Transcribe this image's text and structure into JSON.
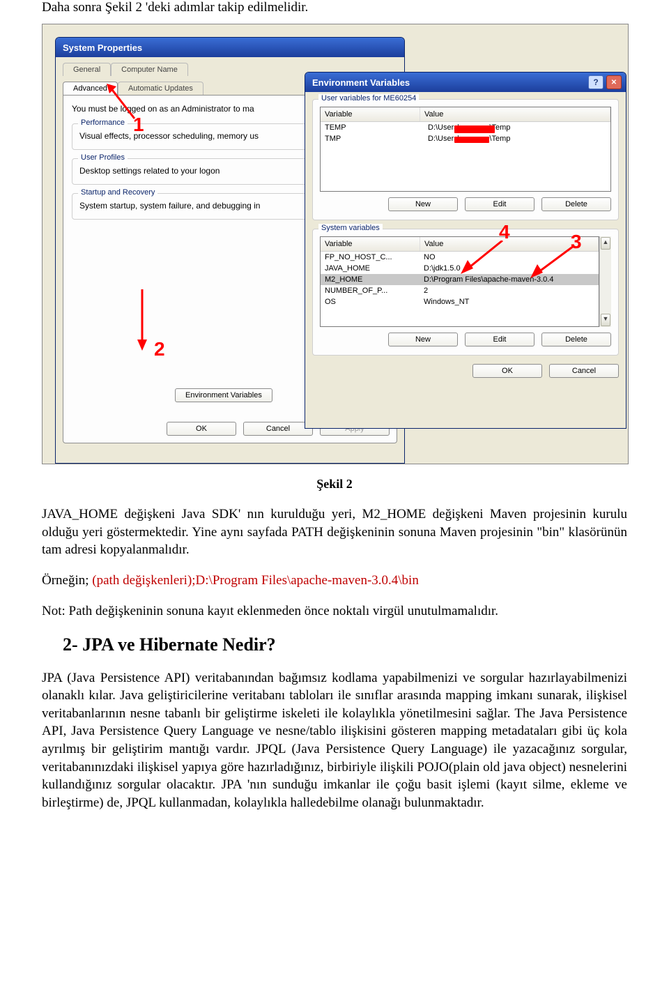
{
  "intro": "Daha sonra Şekil 2 'deki adımlar takip edilmelidir.",
  "win1": {
    "title": "System Properties",
    "tabs_row1": [
      "General",
      "Computer Name"
    ],
    "tabs_row2": [
      "Advanced",
      "Automatic Updates"
    ],
    "admin_note": "You must be logged on as an Administrator to ma",
    "perf": {
      "legend": "Performance",
      "text": "Visual effects, processor scheduling, memory us"
    },
    "user": {
      "legend": "User Profiles",
      "text": "Desktop settings related to your logon"
    },
    "startup": {
      "legend": "Startup and Recovery",
      "text": "System startup, system failure, and debugging in"
    },
    "env_btn": "Environment Variables",
    "footer": {
      "ok": "OK",
      "cancel": "Cancel",
      "apply": "Apply"
    }
  },
  "win2": {
    "title": "Environment Variables",
    "user_legend": "User variables for ME60254",
    "headers": {
      "var": "Variable",
      "val": "Value"
    },
    "user_vars": [
      {
        "var": "TEMP",
        "val": "D:\\Users\\",
        "tail": "\\Temp"
      },
      {
        "var": "TMP",
        "val": "D:\\Users\\",
        "tail": "\\Temp"
      }
    ],
    "btns": {
      "new": "New",
      "edit": "Edit",
      "del": "Delete"
    },
    "sys_legend": "System variables",
    "sys_vars": [
      {
        "var": "FP_NO_HOST_C...",
        "val": "NO"
      },
      {
        "var": "JAVA_HOME",
        "val": "D:\\jdk1.5.0"
      },
      {
        "var": "M2_HOME",
        "val": "D:\\Program Files\\apache-maven-3.0.4"
      },
      {
        "var": "NUMBER_OF_P...",
        "val": "2"
      },
      {
        "var": "OS",
        "val": "Windows_NT"
      }
    ],
    "footer": {
      "ok": "OK",
      "cancel": "Cancel"
    }
  },
  "markers": {
    "m1": "1",
    "m2": "2",
    "m3": "3",
    "m4": "4"
  },
  "caption": "Şekil 2",
  "p1a": "JAVA_HOME değişkeni Java SDK' nın kurulduğu yeri, M2_HOME  değişkeni Maven projesinin kurulu olduğu yeri göstermektedir. Yine aynı sayfada PATH değişkeninin sonuna Maven projesinin \"bin\" klasörünün tam adresi kopyalanmalıdır.",
  "path_label": "Örneğin; ",
  "path_red": "(path değişkenleri);D:\\Program Files\\apache-maven-3.0.4\\bin",
  "p_note": "Not: Path değişkeninin sonuna kayıt eklenmeden önce noktalı virgül unutulmamalıdır.",
  "h2": "2- JPA ve Hibernate Nedir?",
  "p_long": "JPA (Java Persistence API) veritabanından bağımsız kodlama yapabilmenizi ve sorgular hazırlayabilmenizi olanaklı kılar. Java geliştiricilerine veritabanı tabloları ile sınıflar arasında mapping imkanı sunarak, ilişkisel veritabanlarının nesne tabanlı bir geliştirme iskeleti ile kolaylıkla yönetilmesini sağlar. The Java Persistence API, Java Persistence Query Language ve nesne/tablo ilişkisini gösteren mapping metadataları gibi üç kola ayrılmış bir geliştirim mantığı vardır. JPQL (Java Persistence Query Language) ile yazacağınız sorgular, veritabanınızdaki ilişkisel yapıya göre hazırladığınız, birbiriyle ilişkili POJO(plain old java object) nesnelerini kullandığınız sorgular olacaktır. JPA 'nın sunduğu imkanlar ile çoğu basit işlemi (kayıt silme, ekleme ve birleştirme) de, JPQL kullanmadan, kolaylıkla halledebilme olanağı bulunmaktadır."
}
